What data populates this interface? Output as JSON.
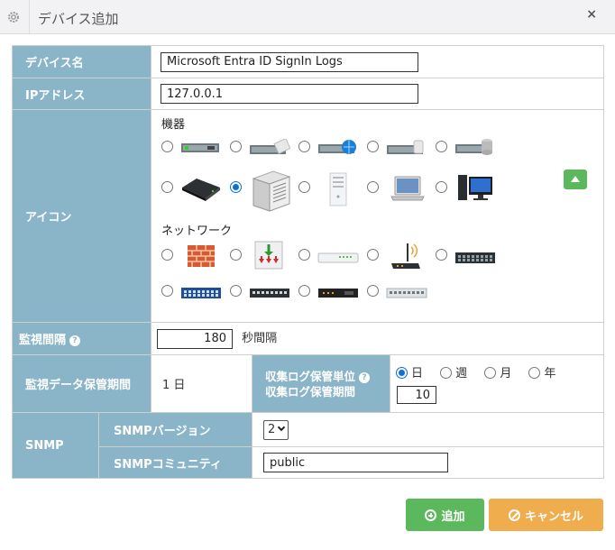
{
  "dialog": {
    "title": "デバイス追加",
    "close": "×"
  },
  "device_name": {
    "label": "デバイス名",
    "value": "Microsoft Entra ID SignIn Logs"
  },
  "ip_address": {
    "label": "IPアドレス",
    "value": "127.0.0.1"
  },
  "icon": {
    "label": "アイコン",
    "equipment_label": "機器",
    "network_label": "ネットワーク",
    "selected": "server-tower",
    "equipment_icons": [
      "server-rack",
      "server-switch",
      "server-globe",
      "server-storage",
      "server-db",
      "appliance-black",
      "server-tower",
      "server-white",
      "laptop",
      "desktop-pc"
    ],
    "network_icons": [
      "firewall",
      "download-device",
      "hub-flat",
      "wifi-router",
      "switch-dark",
      "switch-blue",
      "switch-patch",
      "router-dark",
      "switch-light"
    ]
  },
  "monitor_interval": {
    "label": "監視間隔",
    "help": "?",
    "value": "180",
    "unit": "秒間隔"
  },
  "retention": {
    "label": "監視データ保管期間",
    "value": "1 日",
    "log_unit_label": "収集ログ保管単位",
    "log_period_label": "収集ログ保管期間",
    "help": "?",
    "unit_options": [
      "日",
      "週",
      "月",
      "年"
    ],
    "unit_selected": "日",
    "log_period_value": "10"
  },
  "snmp": {
    "label": "SNMP",
    "version_label": "SNMPバージョン",
    "version_value": "2",
    "community_label": "SNMPコミュニティ",
    "community_value": "public"
  },
  "buttons": {
    "add": "追加",
    "cancel": "キャンセル"
  },
  "colors": {
    "label_bg": "#8ab5c8",
    "add_btn": "#5cb85c",
    "cancel_btn": "#f0ad4e",
    "radio_selected": "#0b6fd6"
  }
}
